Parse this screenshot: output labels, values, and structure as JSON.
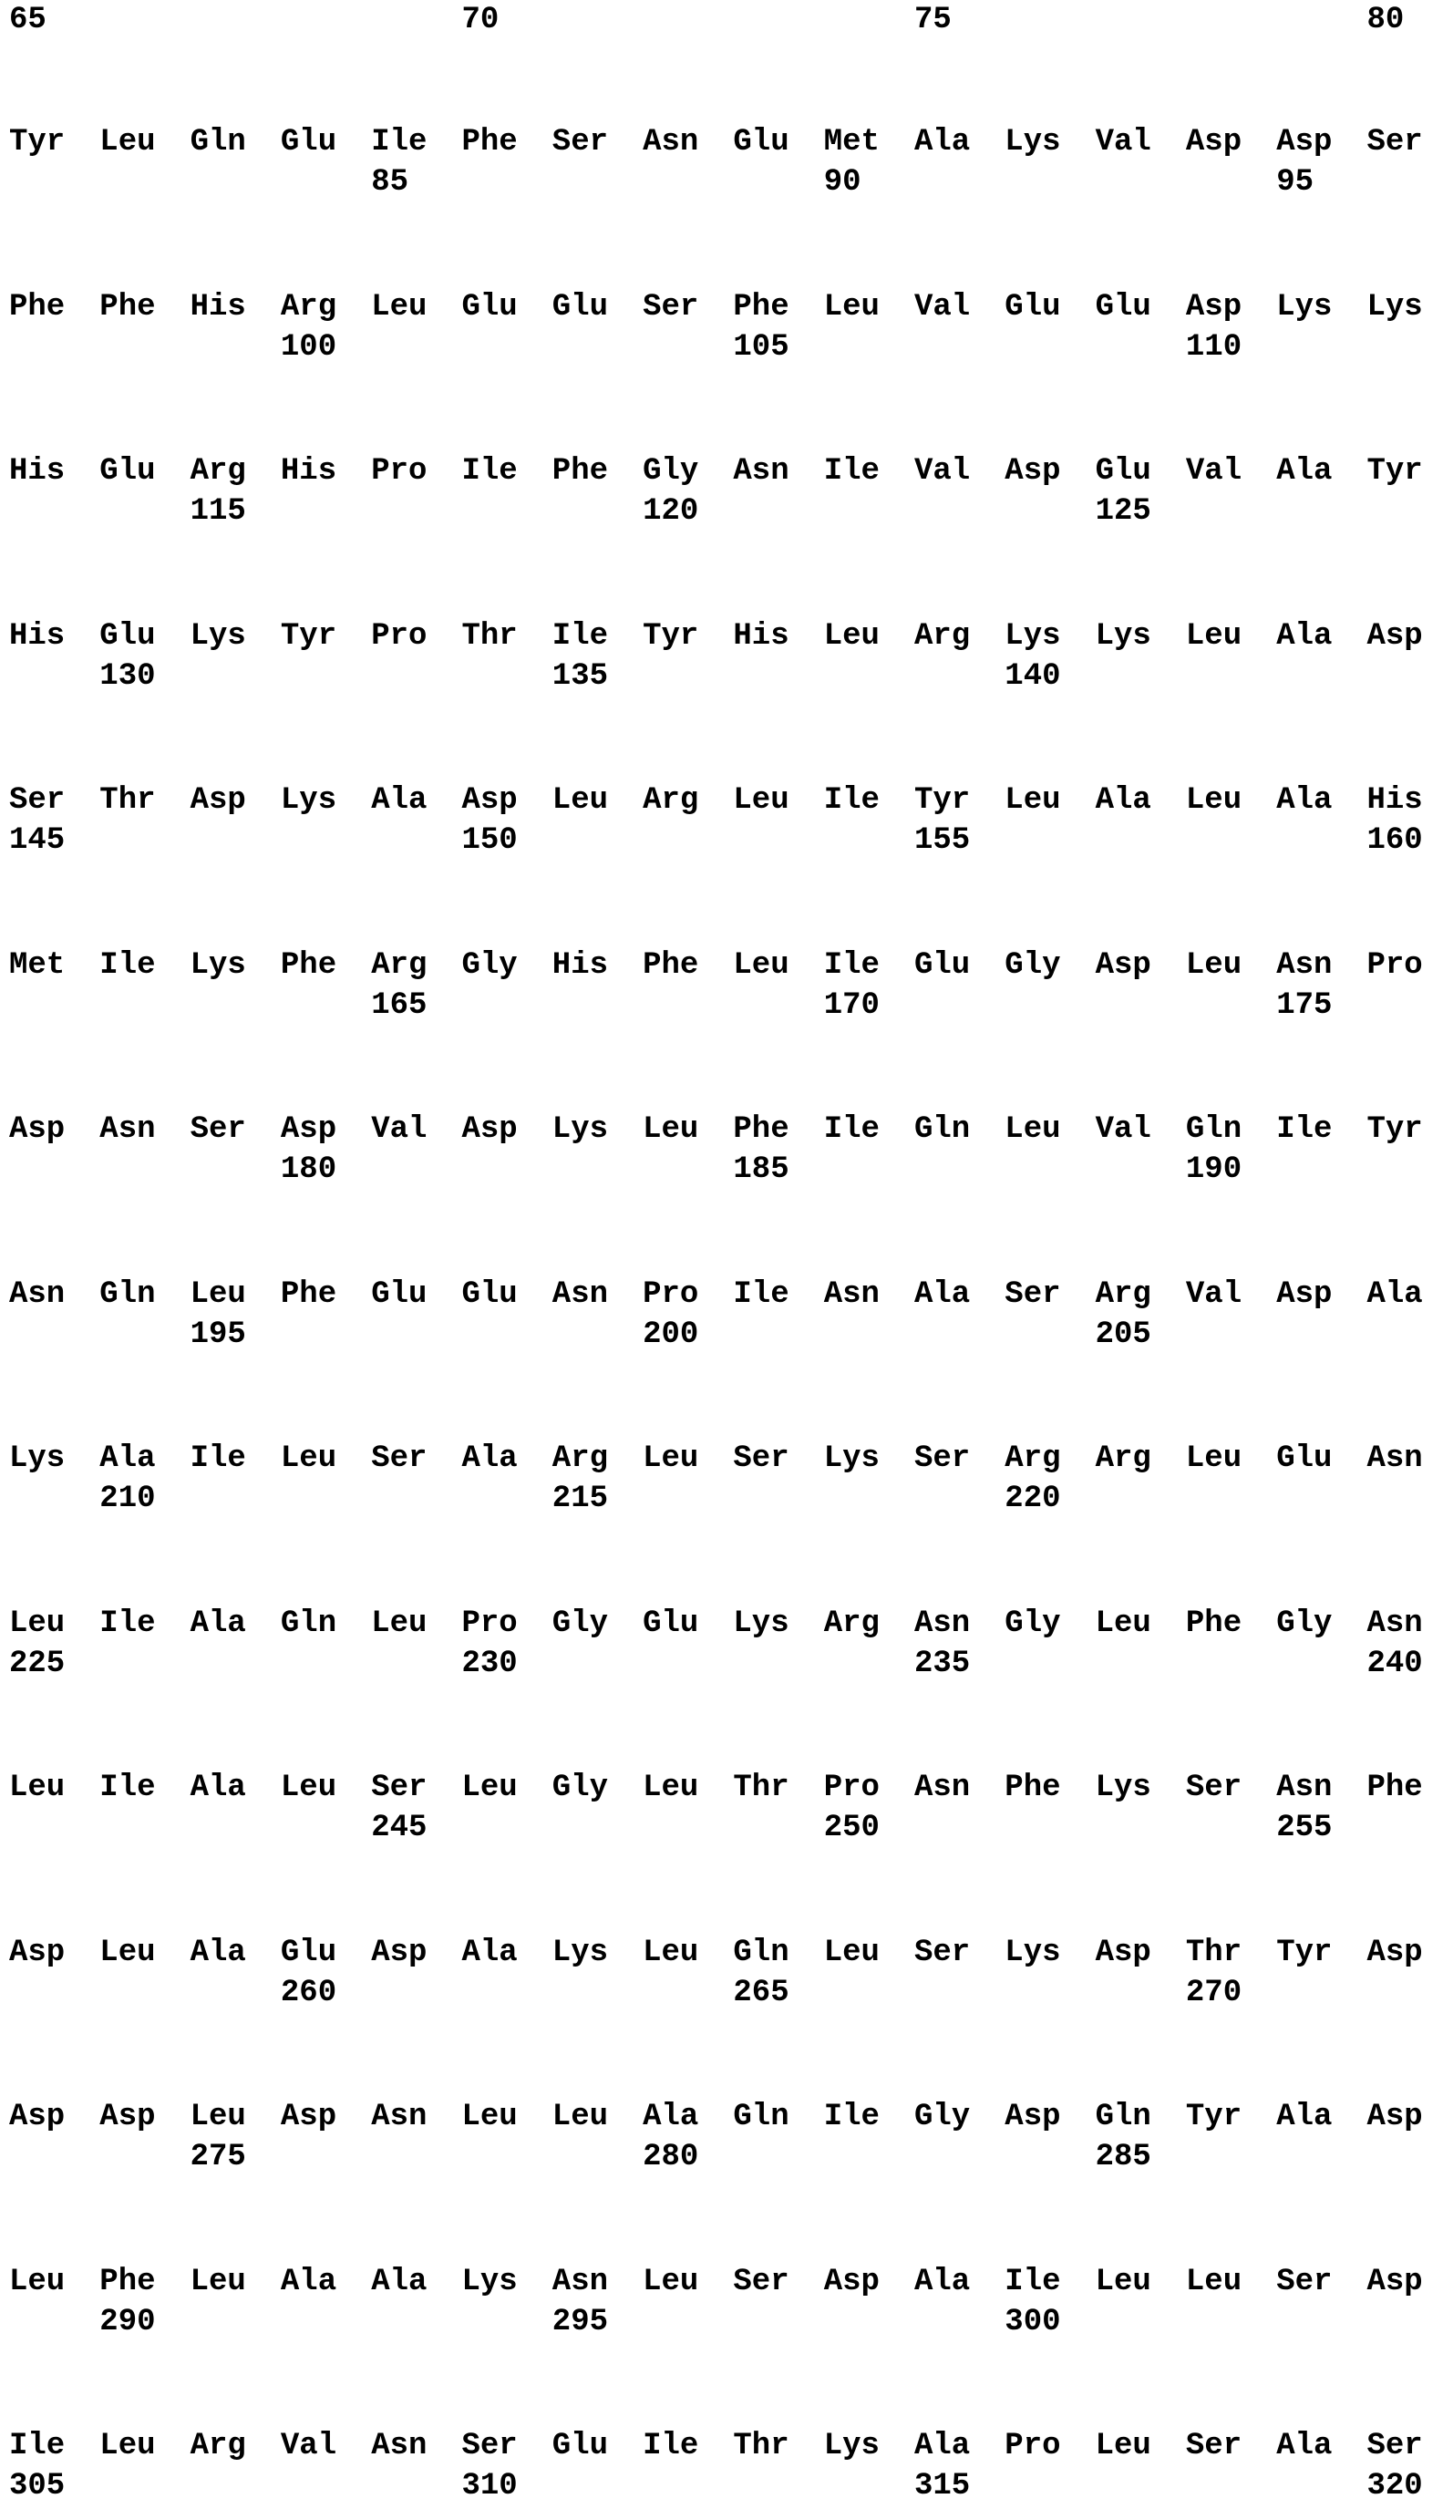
{
  "document": {
    "top_numbers": [
      "65",
      "70",
      "75",
      "80"
    ],
    "blocks": [
      {
        "residues": [
          "Tyr",
          "Leu",
          "Gln",
          "Glu",
          "Ile",
          "Phe",
          "Ser",
          "Asn",
          "Glu",
          "Met",
          "Ala",
          "Lys",
          "Val",
          "Asp",
          "Asp",
          "Ser"
        ],
        "numbers": [
          "",
          "",
          "",
          "",
          "85",
          "",
          "",
          "",
          "",
          "90",
          "",
          "",
          "",
          "",
          "95",
          ""
        ]
      },
      {
        "residues": [
          "Phe",
          "Phe",
          "His",
          "Arg",
          "Leu",
          "Glu",
          "Glu",
          "Ser",
          "Phe",
          "Leu",
          "Val",
          "Glu",
          "Glu",
          "Asp",
          "Lys",
          "Lys"
        ],
        "numbers": [
          "",
          "",
          "",
          "100",
          "",
          "",
          "",
          "",
          "105",
          "",
          "",
          "",
          "",
          "110",
          "",
          ""
        ]
      },
      {
        "residues": [
          "His",
          "Glu",
          "Arg",
          "His",
          "Pro",
          "Ile",
          "Phe",
          "Gly",
          "Asn",
          "Ile",
          "Val",
          "Asp",
          "Glu",
          "Val",
          "Ala",
          "Tyr"
        ],
        "numbers": [
          "",
          "",
          "115",
          "",
          "",
          "",
          "",
          "120",
          "",
          "",
          "",
          "",
          "125",
          "",
          "",
          ""
        ]
      },
      {
        "residues": [
          "His",
          "Glu",
          "Lys",
          "Tyr",
          "Pro",
          "Thr",
          "Ile",
          "Tyr",
          "His",
          "Leu",
          "Arg",
          "Lys",
          "Lys",
          "Leu",
          "Ala",
          "Asp"
        ],
        "numbers": [
          "",
          "130",
          "",
          "",
          "",
          "",
          "135",
          "",
          "",
          "",
          "",
          "140",
          "",
          "",
          "",
          ""
        ]
      },
      {
        "residues": [
          "Ser",
          "Thr",
          "Asp",
          "Lys",
          "Ala",
          "Asp",
          "Leu",
          "Arg",
          "Leu",
          "Ile",
          "Tyr",
          "Leu",
          "Ala",
          "Leu",
          "Ala",
          "His"
        ],
        "numbers": [
          "145",
          "",
          "",
          "",
          "",
          "150",
          "",
          "",
          "",
          "",
          "155",
          "",
          "",
          "",
          "",
          "160"
        ]
      },
      {
        "residues": [
          "Met",
          "Ile",
          "Lys",
          "Phe",
          "Arg",
          "Gly",
          "His",
          "Phe",
          "Leu",
          "Ile",
          "Glu",
          "Gly",
          "Asp",
          "Leu",
          "Asn",
          "Pro"
        ],
        "numbers": [
          "",
          "",
          "",
          "",
          "165",
          "",
          "",
          "",
          "",
          "170",
          "",
          "",
          "",
          "",
          "175",
          ""
        ]
      },
      {
        "residues": [
          "Asp",
          "Asn",
          "Ser",
          "Asp",
          "Val",
          "Asp",
          "Lys",
          "Leu",
          "Phe",
          "Ile",
          "Gln",
          "Leu",
          "Val",
          "Gln",
          "Ile",
          "Tyr"
        ],
        "numbers": [
          "",
          "",
          "",
          "180",
          "",
          "",
          "",
          "",
          "185",
          "",
          "",
          "",
          "",
          "190",
          "",
          ""
        ]
      },
      {
        "residues": [
          "Asn",
          "Gln",
          "Leu",
          "Phe",
          "Glu",
          "Glu",
          "Asn",
          "Pro",
          "Ile",
          "Asn",
          "Ala",
          "Ser",
          "Arg",
          "Val",
          "Asp",
          "Ala"
        ],
        "numbers": [
          "",
          "",
          "195",
          "",
          "",
          "",
          "",
          "200",
          "",
          "",
          "",
          "",
          "205",
          "",
          "",
          ""
        ]
      },
      {
        "residues": [
          "Lys",
          "Ala",
          "Ile",
          "Leu",
          "Ser",
          "Ala",
          "Arg",
          "Leu",
          "Ser",
          "Lys",
          "Ser",
          "Arg",
          "Arg",
          "Leu",
          "Glu",
          "Asn"
        ],
        "numbers": [
          "",
          "210",
          "",
          "",
          "",
          "",
          "215",
          "",
          "",
          "",
          "",
          "220",
          "",
          "",
          "",
          ""
        ]
      },
      {
        "residues": [
          "Leu",
          "Ile",
          "Ala",
          "Gln",
          "Leu",
          "Pro",
          "Gly",
          "Glu",
          "Lys",
          "Arg",
          "Asn",
          "Gly",
          "Leu",
          "Phe",
          "Gly",
          "Asn"
        ],
        "numbers": [
          "225",
          "",
          "",
          "",
          "",
          "230",
          "",
          "",
          "",
          "",
          "235",
          "",
          "",
          "",
          "",
          "240"
        ]
      },
      {
        "residues": [
          "Leu",
          "Ile",
          "Ala",
          "Leu",
          "Ser",
          "Leu",
          "Gly",
          "Leu",
          "Thr",
          "Pro",
          "Asn",
          "Phe",
          "Lys",
          "Ser",
          "Asn",
          "Phe"
        ],
        "numbers": [
          "",
          "",
          "",
          "",
          "245",
          "",
          "",
          "",
          "",
          "250",
          "",
          "",
          "",
          "",
          "255",
          ""
        ]
      },
      {
        "residues": [
          "Asp",
          "Leu",
          "Ala",
          "Glu",
          "Asp",
          "Ala",
          "Lys",
          "Leu",
          "Gln",
          "Leu",
          "Ser",
          "Lys",
          "Asp",
          "Thr",
          "Tyr",
          "Asp"
        ],
        "numbers": [
          "",
          "",
          "",
          "260",
          "",
          "",
          "",
          "",
          "265",
          "",
          "",
          "",
          "",
          "270",
          "",
          ""
        ]
      },
      {
        "residues": [
          "Asp",
          "Asp",
          "Leu",
          "Asp",
          "Asn",
          "Leu",
          "Leu",
          "Ala",
          "Gln",
          "Ile",
          "Gly",
          "Asp",
          "Gln",
          "Tyr",
          "Ala",
          "Asp"
        ],
        "numbers": [
          "",
          "",
          "275",
          "",
          "",
          "",
          "",
          "280",
          "",
          "",
          "",
          "",
          "285",
          "",
          "",
          ""
        ]
      },
      {
        "residues": [
          "Leu",
          "Phe",
          "Leu",
          "Ala",
          "Ala",
          "Lys",
          "Asn",
          "Leu",
          "Ser",
          "Asp",
          "Ala",
          "Ile",
          "Leu",
          "Leu",
          "Ser",
          "Asp"
        ],
        "numbers": [
          "",
          "290",
          "",
          "",
          "",
          "",
          "295",
          "",
          "",
          "",
          "",
          "300",
          "",
          "",
          "",
          ""
        ]
      },
      {
        "residues": [
          "Ile",
          "Leu",
          "Arg",
          "Val",
          "Asn",
          "Ser",
          "Glu",
          "Ile",
          "Thr",
          "Lys",
          "Ala",
          "Pro",
          "Leu",
          "Ser",
          "Ala",
          "Ser"
        ],
        "numbers": [
          "305",
          "",
          "",
          "",
          "",
          "310",
          "",
          "",
          "",
          "",
          "315",
          "",
          "",
          "",
          "",
          "320"
        ]
      }
    ]
  }
}
